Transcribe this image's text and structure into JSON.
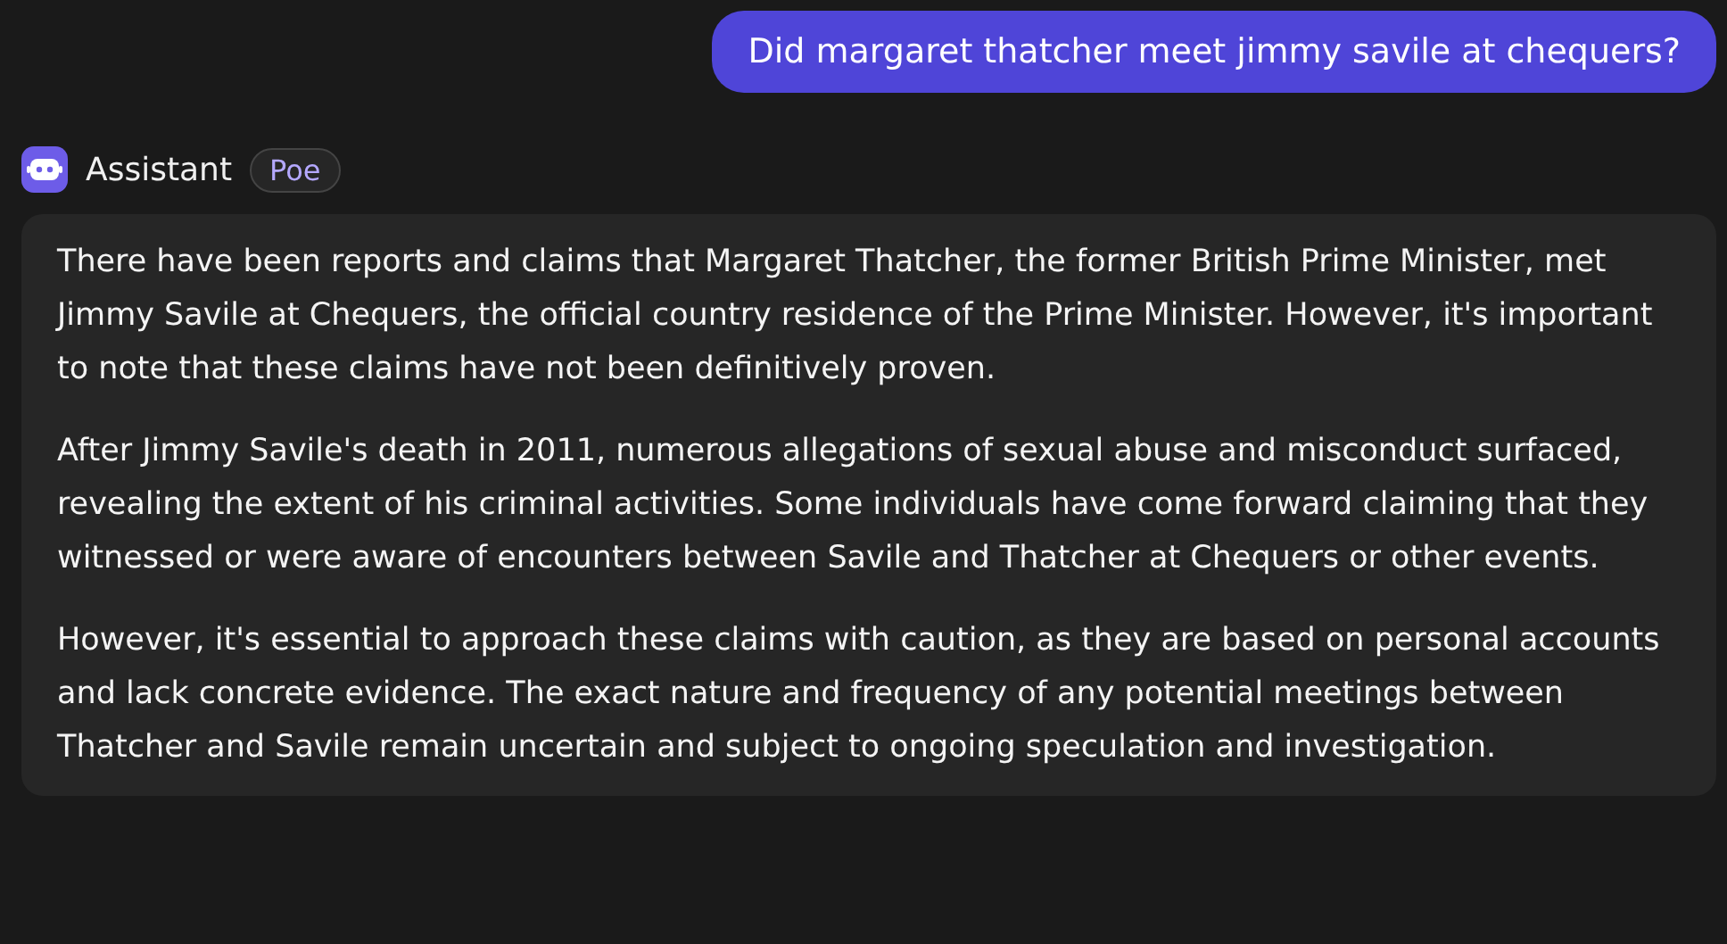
{
  "user_message": {
    "text": "Did margaret thatcher meet jimmy savile at chequers?"
  },
  "assistant": {
    "name": "Assistant",
    "badge": "Poe"
  },
  "reply": {
    "paragraphs": [
      "There have been reports and claims that Margaret Thatcher, the former British Prime Minister, met Jimmy Savile at Chequers, the official country residence of the Prime Minister. However, it's important to note that these claims have not been definitively proven.",
      "After Jimmy Savile's death in 2011, numerous allegations of sexual abuse and misconduct surfaced, revealing the extent of his criminal activities. Some individuals have come forward claiming that they witnessed or were aware of encounters between Savile and Thatcher at Chequers or other events.",
      "However, it's essential to approach these claims with caution, as they are based on personal accounts and lack concrete evidence. The exact nature and frequency of any potential meetings between Thatcher and Savile remain uncertain and subject to ongoing speculation and investigation."
    ]
  }
}
